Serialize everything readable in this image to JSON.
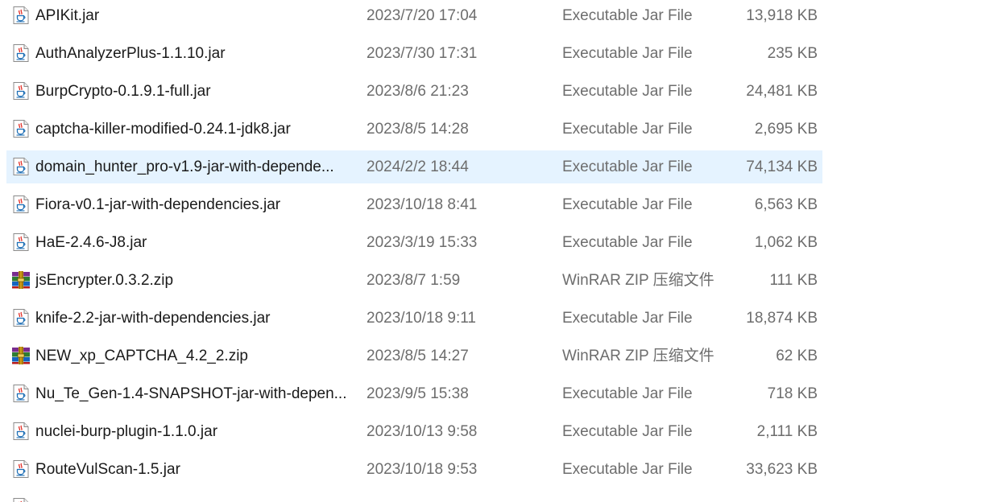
{
  "files": [
    {
      "name": "APIKit.jar",
      "date": "2023/7/20 17:04",
      "type": "Executable Jar File",
      "size": "13,918 KB",
      "icon": "jar-file-icon"
    },
    {
      "name": "AuthAnalyzerPlus-1.1.10.jar",
      "date": "2023/7/30 17:31",
      "type": "Executable Jar File",
      "size": "235 KB",
      "icon": "jar-file-icon"
    },
    {
      "name": "BurpCrypto-0.1.9.1-full.jar",
      "date": "2023/8/6 21:23",
      "type": "Executable Jar File",
      "size": "24,481 KB",
      "icon": "jar-file-icon"
    },
    {
      "name": "captcha-killer-modified-0.24.1-jdk8.jar",
      "date": "2023/8/5 14:28",
      "type": "Executable Jar File",
      "size": "2,695 KB",
      "icon": "jar-file-icon"
    },
    {
      "name": "domain_hunter_pro-v1.9-jar-with-depende...",
      "date": "2024/2/2 18:44",
      "type": "Executable Jar File",
      "size": "74,134 KB",
      "icon": "jar-file-icon",
      "selected": true
    },
    {
      "name": "Fiora-v0.1-jar-with-dependencies.jar",
      "date": "2023/10/18 8:41",
      "type": "Executable Jar File",
      "size": "6,563 KB",
      "icon": "jar-file-icon"
    },
    {
      "name": "HaE-2.4.6-J8.jar",
      "date": "2023/3/19 15:33",
      "type": "Executable Jar File",
      "size": "1,062 KB",
      "icon": "jar-file-icon"
    },
    {
      "name": "jsEncrypter.0.3.2.zip",
      "date": "2023/8/7 1:59",
      "type": "WinRAR ZIP 压缩文件",
      "size": "111 KB",
      "icon": "winrar-zip-icon"
    },
    {
      "name": "knife-2.2-jar-with-dependencies.jar",
      "date": "2023/10/18 9:11",
      "type": "Executable Jar File",
      "size": "18,874 KB",
      "icon": "jar-file-icon"
    },
    {
      "name": "NEW_xp_CAPTCHA_4.2_2.zip",
      "date": "2023/8/5 14:27",
      "type": "WinRAR ZIP 压缩文件",
      "size": "62 KB",
      "icon": "winrar-zip-icon"
    },
    {
      "name": "Nu_Te_Gen-1.4-SNAPSHOT-jar-with-depen...",
      "date": "2023/9/5 15:38",
      "type": "Executable Jar File",
      "size": "718 KB",
      "icon": "jar-file-icon"
    },
    {
      "name": "nuclei-burp-plugin-1.1.0.jar",
      "date": "2023/10/13 9:58",
      "type": "Executable Jar File",
      "size": "2,111 KB",
      "icon": "jar-file-icon"
    },
    {
      "name": "RouteVulScan-1.5.jar",
      "date": "2023/10/18 9:53",
      "type": "Executable Jar File",
      "size": "33,623 KB",
      "icon": "jar-file-icon"
    },
    {
      "name": "",
      "date": "",
      "type": "",
      "size": "",
      "icon": "jar-file-icon"
    }
  ],
  "colors": {
    "selection": "#e5f3ff",
    "secondary_text": "#6d6d6d",
    "primary_text": "#1a1a1a"
  }
}
